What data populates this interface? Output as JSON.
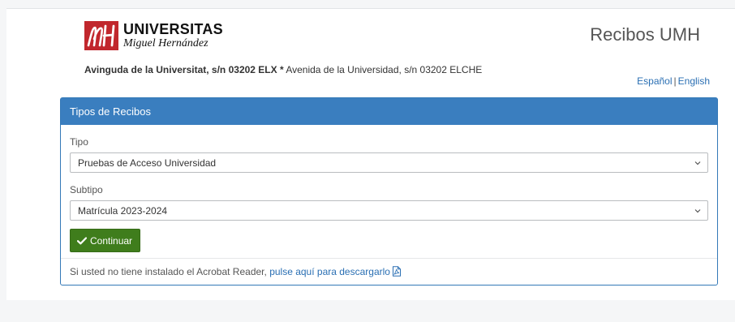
{
  "header": {
    "logo": {
      "line1": "UNIVERSITAS",
      "line2": "Miguel Hernández",
      "brand_color": "#c1272d"
    },
    "app_title": "Recibos UMH",
    "address": {
      "valencian": "Avinguda de la Universitat, s/n 03202 ELX",
      "separator": "*",
      "spanish": "Avenida de la Universidad, s/n 03202 ELCHE"
    },
    "languages": {
      "spanish": "Español",
      "separator": "|",
      "english": "English"
    }
  },
  "panel": {
    "heading": "Tipos de Recibos",
    "heading_color": "#3a7ebf",
    "tipo": {
      "label": "Tipo",
      "selected": "Pruebas de Acceso Universidad",
      "icon": "chevron-down-icon"
    },
    "subtipo": {
      "label": "Subtipo",
      "selected": "Matrícula 2023-2024",
      "icon": "chevron-down-icon"
    },
    "continue_button": {
      "label": "Continuar",
      "icon": "check-icon",
      "color": "#3f7d1c"
    },
    "footer": {
      "text": "Si usted no tiene instalado el Acrobat Reader,",
      "link": "pulse aquí para descargarlo",
      "icon": "pdf-file-icon"
    }
  }
}
